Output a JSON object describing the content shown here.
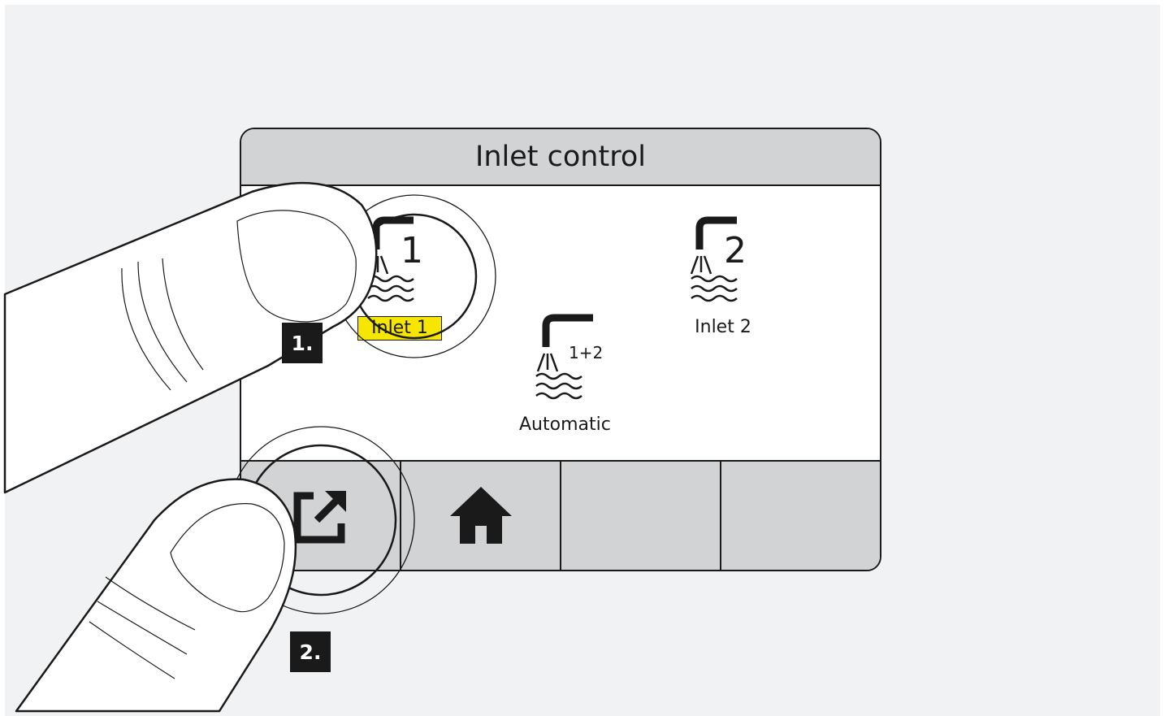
{
  "screen": {
    "title": "Inlet control",
    "options": [
      {
        "id": "inlet-1",
        "number": "1",
        "label": "Inlet 1",
        "selected": true
      },
      {
        "id": "inlet-2",
        "number": "2",
        "label": "Inlet 2",
        "selected": false
      },
      {
        "id": "automatic",
        "number": "1+2",
        "label": "Automatic",
        "selected": false
      }
    ],
    "soft_keys": [
      {
        "icon": "exit-icon"
      },
      {
        "icon": "home-icon"
      },
      {
        "icon": ""
      },
      {
        "icon": ""
      }
    ]
  },
  "steps": [
    "1.",
    "2."
  ],
  "colors": {
    "highlight": "#f6e600",
    "bar": "#d2d3d5",
    "background": "#f1f2f4",
    "ink": "#1a1a1a"
  }
}
